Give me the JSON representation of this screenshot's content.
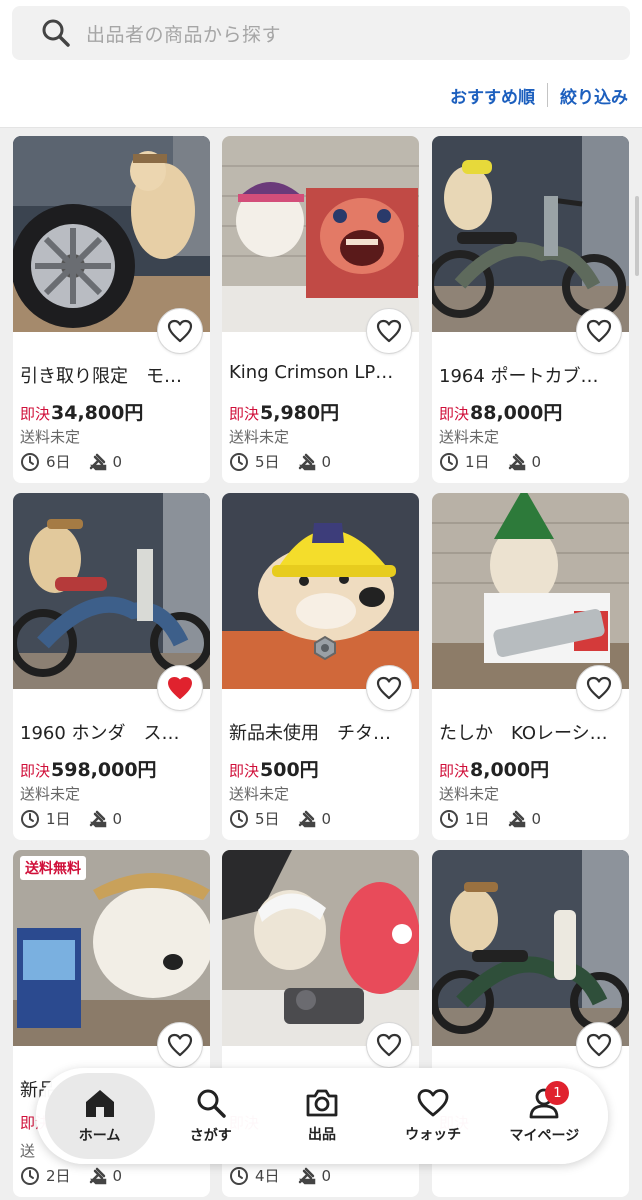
{
  "search": {
    "placeholder": "出品者の商品から探す"
  },
  "sort": {
    "recommended": "おすすめ順",
    "filter": "絞り込み"
  },
  "price_label": "即決",
  "items": [
    {
      "title": "引き取り限定　モ…",
      "price": "34,800円",
      "shipping": "送料未定",
      "time_left": "6日",
      "bids": "0",
      "watched": false
    },
    {
      "title": "King Crimson LP…",
      "price": "5,980円",
      "shipping": "送料未定",
      "time_left": "5日",
      "bids": "0",
      "watched": false
    },
    {
      "title": "1964 ポートカブ…",
      "price": "88,000円",
      "shipping": "送料未定",
      "time_left": "1日",
      "bids": "0",
      "watched": false
    },
    {
      "title": "1960 ホンダ　ス…",
      "price": "598,000円",
      "shipping": "送料未定",
      "time_left": "1日",
      "bids": "0",
      "watched": true
    },
    {
      "title": "新品未使用　チタ…",
      "price": "500円",
      "shipping": "送料未定",
      "time_left": "5日",
      "bids": "0",
      "watched": false
    },
    {
      "title": "たしか　KOレーシ…",
      "price": "8,000円",
      "shipping": "送料未定",
      "time_left": "1日",
      "bids": "0",
      "watched": false
    },
    {
      "badge": "送料無料",
      "title": "新品",
      "price": "",
      "shipping": "送",
      "time_left": "2日",
      "bids": "0",
      "watched": false
    },
    {
      "title": "",
      "price": "",
      "shipping": "",
      "time_left": "4日",
      "bids": "0",
      "watched": false
    },
    {
      "title": "",
      "price": "",
      "shipping": "",
      "time_left": "",
      "bids": "",
      "watched": false
    }
  ],
  "nav": {
    "home": "ホーム",
    "search": "さがす",
    "sell": "出品",
    "watch": "ウォッチ",
    "mypage": "マイページ",
    "mypage_badge": "1"
  },
  "colors": {
    "accent": "#1c5fbe",
    "price_label": "#d0103a",
    "heart_active": "#e0222e"
  }
}
